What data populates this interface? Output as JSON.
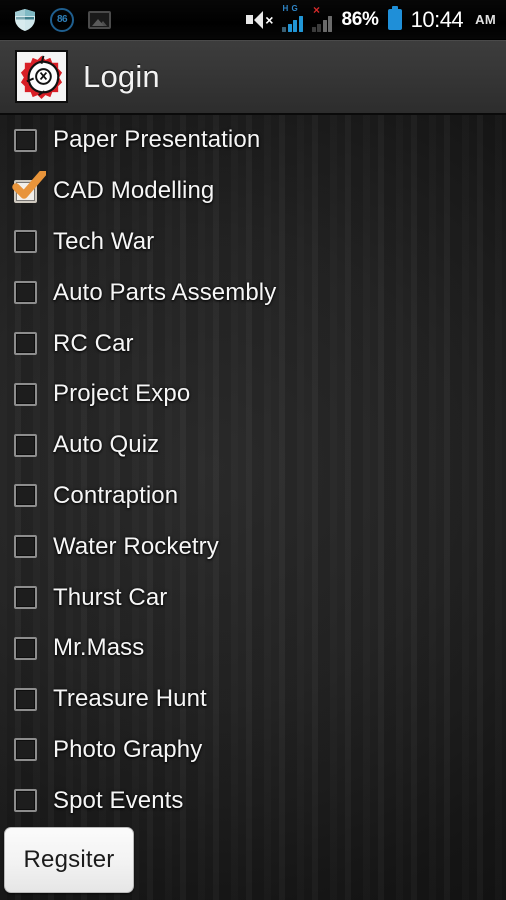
{
  "status_bar": {
    "left_icons": [
      {
        "name": "shield-icon",
        "label": ""
      },
      {
        "name": "speedometer-badge-icon",
        "label": "86"
      },
      {
        "name": "gallery-icon",
        "label": ""
      }
    ],
    "volume_muted_icon": "volume-mute-icon",
    "mute_x": "×",
    "signal_1": {
      "label": "H G",
      "icon": "signal-bars-active-icon"
    },
    "signal_2": {
      "label": "×",
      "icon": "signal-bars-inactive-icon"
    },
    "battery_percent": "86%",
    "battery_icon": "battery-full-icon",
    "time": "10:44",
    "meridiem": "AM"
  },
  "action_bar": {
    "app_icon": "gear-logo-icon",
    "title": "Login"
  },
  "event_list": [
    {
      "label": "Paper Presentation",
      "checked": false
    },
    {
      "label": "CAD Modelling",
      "checked": true
    },
    {
      "label": "Tech War",
      "checked": false
    },
    {
      "label": "Auto Parts Assembly",
      "checked": false
    },
    {
      "label": "RC Car",
      "checked": false
    },
    {
      "label": "Project Expo",
      "checked": false
    },
    {
      "label": "Auto Quiz",
      "checked": false
    },
    {
      "label": "Contraption",
      "checked": false
    },
    {
      "label": "Water Rocketry",
      "checked": false
    },
    {
      "label": "Thurst Car",
      "checked": false
    },
    {
      "label": "Mr.Mass",
      "checked": false
    },
    {
      "label": "Treasure Hunt",
      "checked": false
    },
    {
      "label": "Photo Graphy",
      "checked": false
    },
    {
      "label": "Spot Events",
      "checked": false
    }
  ],
  "register_button": {
    "label": "Regsiter"
  },
  "colors": {
    "accent_check": "#e8943a",
    "signal_active": "#2196d6",
    "battery": "#1f8fd8",
    "logo_red": "#d81f26",
    "background": "#1a1a1a",
    "action_bar": "#363636"
  }
}
